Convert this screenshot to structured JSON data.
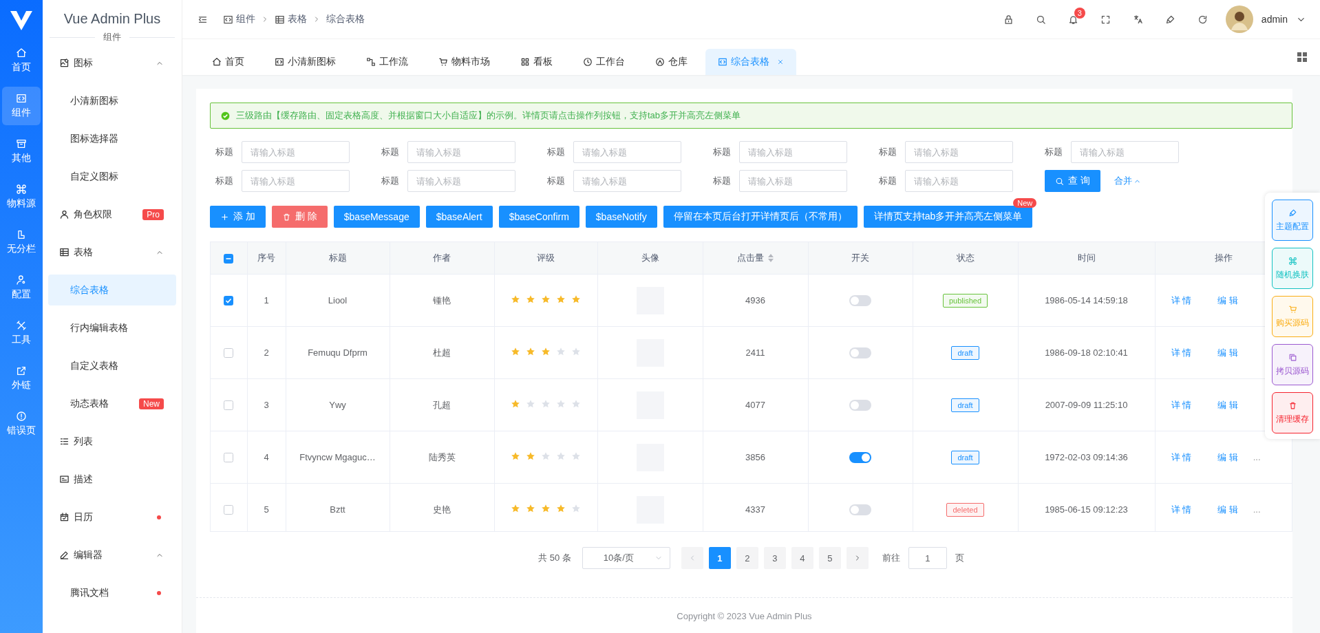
{
  "rail": {
    "items": [
      {
        "label": "首页",
        "selected": false
      },
      {
        "label": "组件",
        "selected": true
      },
      {
        "label": "其他",
        "selected": false
      },
      {
        "label": "物料源",
        "selected": false
      },
      {
        "label": "无分栏",
        "selected": false
      },
      {
        "label": "配置",
        "selected": false
      },
      {
        "label": "工具",
        "selected": false
      },
      {
        "label": "外链",
        "selected": false
      },
      {
        "label": "错误页",
        "selected": false
      }
    ]
  },
  "sidebar": {
    "title": "Vue Admin Plus",
    "section": "组件",
    "items": [
      {
        "label": "图标",
        "expanded": true,
        "selected": false,
        "children": [
          {
            "label": "小清新图标",
            "selected": false
          },
          {
            "label": "图标选择器",
            "selected": false
          },
          {
            "label": "自定义图标",
            "selected": false
          }
        ]
      },
      {
        "label": "角色权限",
        "selected": false,
        "badge": "Pro"
      },
      {
        "label": "表格",
        "expanded": true,
        "selected": false,
        "children": [
          {
            "label": "综合表格",
            "selected": true
          },
          {
            "label": "行内编辑表格",
            "selected": false
          },
          {
            "label": "自定义表格",
            "selected": false
          },
          {
            "label": "动态表格",
            "selected": false,
            "badge": "New"
          }
        ]
      },
      {
        "label": "列表",
        "selected": false
      },
      {
        "label": "描述",
        "selected": false
      },
      {
        "label": "日历",
        "selected": false,
        "dot": true
      },
      {
        "label": "编辑器",
        "expanded": true,
        "selected": false,
        "children": [
          {
            "label": "腾讯文档",
            "selected": false,
            "dot": true
          }
        ]
      }
    ]
  },
  "header": {
    "breadcrumb": [
      "组件",
      "表格",
      "综合表格"
    ],
    "notifications": "3",
    "user": "admin"
  },
  "tabs": [
    {
      "label": "首页",
      "selected": false
    },
    {
      "label": "小清新图标",
      "selected": false
    },
    {
      "label": "工作流",
      "selected": false
    },
    {
      "label": "物料市场",
      "selected": false
    },
    {
      "label": "看板",
      "selected": false
    },
    {
      "label": "工作台",
      "selected": false
    },
    {
      "label": "仓库",
      "selected": false
    },
    {
      "label": "综合表格",
      "selected": true
    }
  ],
  "alert": "三级路由【缓存路由、固定表格高度、并根据窗口大小自适应】的示例。详情页请点击操作列按钮，支持tab多开并高亮左侧菜单",
  "form": {
    "fields": [
      {
        "label": "标题",
        "placeholder": "请输入标题"
      },
      {
        "label": "标题",
        "placeholder": "请输入标题"
      },
      {
        "label": "标题",
        "placeholder": "请输入标题"
      },
      {
        "label": "标题",
        "placeholder": "请输入标题"
      },
      {
        "label": "标题",
        "placeholder": "请输入标题"
      },
      {
        "label": "标题",
        "placeholder": "请输入标题"
      },
      {
        "label": "标题",
        "placeholder": "请输入标题"
      },
      {
        "label": "标题",
        "placeholder": "请输入标题"
      },
      {
        "label": "标题",
        "placeholder": "请输入标题"
      },
      {
        "label": "标题",
        "placeholder": "请输入标题"
      },
      {
        "label": "标题",
        "placeholder": "请输入标题"
      }
    ],
    "query": "查 询",
    "collapse": "合并"
  },
  "buttons": [
    {
      "label": "添 加",
      "kind": "add"
    },
    {
      "label": "删 除",
      "kind": "delete"
    },
    {
      "label": "$baseMessage",
      "kind": "plain"
    },
    {
      "label": "$baseAlert",
      "kind": "plain"
    },
    {
      "label": "$baseConfirm",
      "kind": "plain"
    },
    {
      "label": "$baseNotify",
      "kind": "plain"
    },
    {
      "label": "停留在本页后台打开详情页后（不常用）",
      "kind": "plain"
    },
    {
      "label": "详情页支持tab多开并高亮左侧菜单",
      "kind": "plain",
      "badge": "New"
    }
  ],
  "table": {
    "select_all_indeterminate": true,
    "columns": [
      {
        "label": "序号"
      },
      {
        "label": "标题"
      },
      {
        "label": "作者"
      },
      {
        "label": "评级"
      },
      {
        "label": "头像"
      },
      {
        "label": "点击量",
        "sortable": true
      },
      {
        "label": "开关"
      },
      {
        "label": "状态"
      },
      {
        "label": "时间"
      },
      {
        "label": "操作"
      }
    ],
    "rows": [
      {
        "selected": true,
        "index": "1",
        "title": "Liool",
        "author": "锺艳",
        "stars": 5,
        "clicks": "4936",
        "on": false,
        "status": {
          "text": "published",
          "color": "#67c23a"
        },
        "time": "1986-05-14 14:59:18",
        "actions": [
          "详 情",
          "编 辑"
        ]
      },
      {
        "selected": false,
        "index": "2",
        "title": "Femuqu Dfprm",
        "author": "杜超",
        "stars": 3,
        "clicks": "2411",
        "on": false,
        "status": {
          "text": "draft",
          "color": "#1890ff"
        },
        "time": "1986-09-18 02:10:41",
        "actions": [
          "详 情",
          "编 辑"
        ]
      },
      {
        "selected": false,
        "index": "3",
        "title": "Ywy",
        "author": "孔超",
        "stars": 1,
        "clicks": "4077",
        "on": false,
        "status": {
          "text": "draft",
          "color": "#1890ff"
        },
        "time": "2007-09-09 11:25:10",
        "actions": [
          "详 情",
          "编 辑"
        ]
      },
      {
        "selected": false,
        "index": "4",
        "title": "Ftvyncw Mgaguc…",
        "author": "陆秀英",
        "stars": 2,
        "clicks": "3856",
        "on": true,
        "status": {
          "text": "draft",
          "color": "#1890ff"
        },
        "time": "1972-02-03 09:14:36",
        "actions": [
          "详 情",
          "编 辑"
        ],
        "more": "..."
      },
      {
        "selected": false,
        "index": "5",
        "title": "Bztt",
        "author": "史艳",
        "stars": 4,
        "clicks": "4337",
        "on": false,
        "status": {
          "text": "deleted",
          "color": "#f56c6c"
        },
        "time": "1985-06-15 09:12:23",
        "actions": [
          "详 情",
          "编 辑"
        ],
        "more": "..."
      }
    ]
  },
  "pagination": {
    "total": "共 50 条",
    "page_size": "10条/页",
    "pages": [
      {
        "label": "1",
        "selected": true
      },
      {
        "label": "2",
        "selected": false
      },
      {
        "label": "3",
        "selected": false
      },
      {
        "label": "4",
        "selected": false
      },
      {
        "label": "5",
        "selected": false
      }
    ],
    "goto": "前往",
    "goto_value": "1",
    "goto_suffix": "页"
  },
  "footer": "Copyright © 2023 Vue Admin Plus",
  "float_panel": {
    "items": [
      {
        "label": "主题配置",
        "color": "#1890ff"
      },
      {
        "label": "随机换肤",
        "color": "#13c2c2"
      },
      {
        "label": "购买源码",
        "color": "#faad14"
      },
      {
        "label": "拷贝源码",
        "color": "#9b59d0"
      },
      {
        "label": "清理缓存",
        "color": "#f5222d"
      }
    ]
  }
}
